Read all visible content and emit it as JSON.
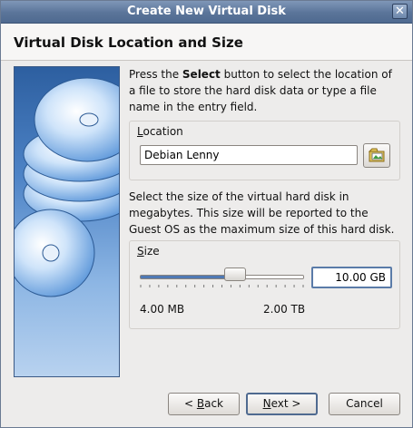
{
  "window": {
    "title": "Create New Virtual Disk",
    "close_glyph": "✕"
  },
  "header": {
    "title": "Virtual Disk Location and Size"
  },
  "intro": {
    "pre": "Press the ",
    "bold": "Select",
    "post": " button to select the location of a file to store the hard disk data or type a file name in the entry field."
  },
  "location": {
    "label_ul": "L",
    "label_rest": "ocation",
    "value": "Debian Lenny",
    "browse_icon": "folder-open-icon"
  },
  "size_desc": "Select the size of the virtual hard disk in megabytes. This size will be reported to the Guest OS as the maximum size of this hard disk.",
  "size": {
    "label_ul": "S",
    "label_rest": "ize",
    "value": "10.00 GB",
    "min_label": "4.00 MB",
    "max_label": "2.00 TB",
    "slider_fraction": 0.58
  },
  "buttons": {
    "back": {
      "pre": "< ",
      "ul": "B",
      "rest": "ack"
    },
    "next": {
      "ul": "N",
      "rest": "ext >"
    },
    "cancel": "Cancel"
  },
  "colors": {
    "accent": "#4f6a90",
    "side_top": "#2d5fa0",
    "side_bottom": "#b8d2ef"
  }
}
